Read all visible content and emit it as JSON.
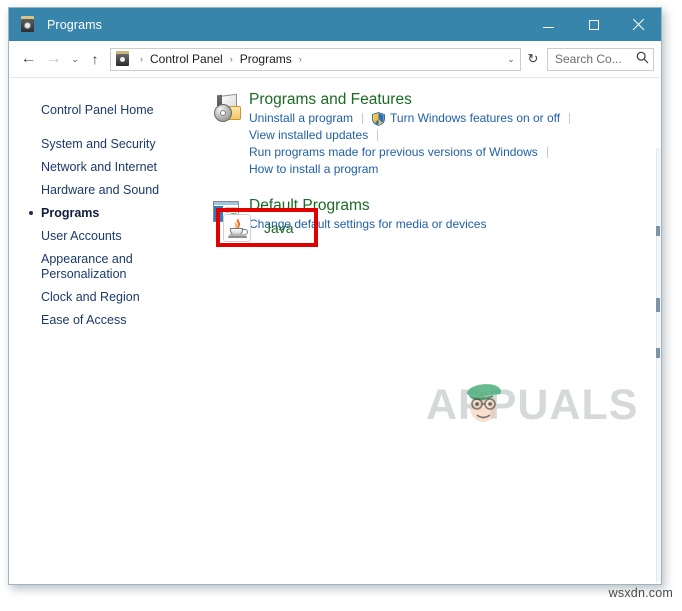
{
  "window": {
    "title": "Programs",
    "title_icon": "control-panel-icon",
    "controls": {
      "minimize": "−",
      "maximize": "□",
      "close": "✕"
    }
  },
  "navbar": {
    "back": "←",
    "forward": "→",
    "recent": "⌄",
    "up": "↑",
    "address_icon": "control-panel-icon",
    "breadcrumbs": [
      "Control Panel",
      "Programs"
    ],
    "separator": "›",
    "dropdown": "⌄",
    "refresh": "↻",
    "search": {
      "placeholder": "Search Co...",
      "icon": "search-icon"
    }
  },
  "sidebar": {
    "home": "Control Panel Home",
    "items": [
      {
        "label": "System and Security",
        "current": false
      },
      {
        "label": "Network and Internet",
        "current": false
      },
      {
        "label": "Hardware and Sound",
        "current": false
      },
      {
        "label": "Programs",
        "current": true
      },
      {
        "label": "User Accounts",
        "current": false
      },
      {
        "label": "Appearance and Personalization",
        "current": false
      },
      {
        "label": "Clock and Region",
        "current": false
      },
      {
        "label": "Ease of Access",
        "current": false
      }
    ]
  },
  "content": {
    "categories": [
      {
        "icon": "programs-and-features-icon",
        "title": "Programs and Features",
        "rows": [
          [
            {
              "text": "Uninstall a program",
              "shield": false
            },
            {
              "text": "Turn Windows features on or off",
              "shield": true
            }
          ],
          [
            {
              "text": "View installed updates",
              "shield": false
            }
          ],
          [
            {
              "text": "Run programs made for previous versions of Windows",
              "shield": false
            }
          ],
          [
            {
              "text": "How to install a program",
              "shield": false
            }
          ]
        ]
      },
      {
        "icon": "default-programs-icon",
        "title": "Default Programs",
        "rows": [
          [
            {
              "text": "Change default settings for media or devices",
              "shield": false
            }
          ]
        ]
      }
    ],
    "java_item": {
      "icon": "java-coffee-cup-icon",
      "label": "Java",
      "highlight_color": "#e00000"
    }
  },
  "watermarks": {
    "appuals": "APPUALS",
    "site": "wsxdn.com"
  },
  "colors": {
    "titlebar": "#3885ac",
    "category_title": "#1a6b23",
    "link": "#1f5fa8",
    "sidebar_text": "#1b3a6b",
    "highlight": "#e00000"
  }
}
